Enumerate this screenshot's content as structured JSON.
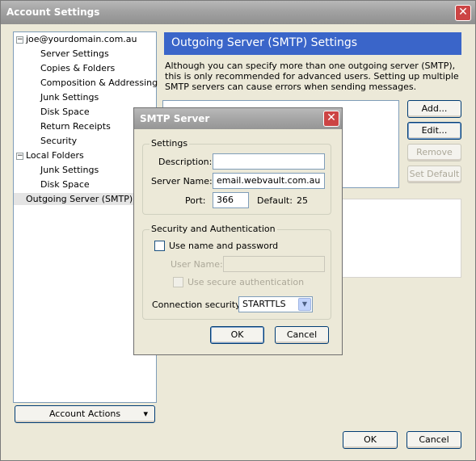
{
  "window": {
    "title": "Account Settings",
    "close_glyph": "✕"
  },
  "tree": {
    "items": [
      {
        "label": "joe@yourdomain.com.au",
        "level": 0,
        "expanded": true
      },
      {
        "label": "Server Settings",
        "level": 1
      },
      {
        "label": "Copies & Folders",
        "level": 1
      },
      {
        "label": "Composition & Addressing",
        "level": 1
      },
      {
        "label": "Junk Settings",
        "level": 1
      },
      {
        "label": "Disk Space",
        "level": 1
      },
      {
        "label": "Return Receipts",
        "level": 1
      },
      {
        "label": "Security",
        "level": 1
      },
      {
        "label": "Local Folders",
        "level": 0,
        "expanded": true
      },
      {
        "label": "Junk Settings",
        "level": 1
      },
      {
        "label": "Disk Space",
        "level": 1
      },
      {
        "label": "Outgoing Server (SMTP)",
        "level": 0,
        "selected": true
      }
    ],
    "expander_glyph": "−"
  },
  "account_actions": {
    "label": "Account Actions",
    "arrow": "▾"
  },
  "panel": {
    "header": "Outgoing Server (SMTP) Settings",
    "description": "Although you can specify more than one outgoing server (SMTP), this is only recommended for advanced users. Setting up multiple SMTP servers can cause errors when sending messages.",
    "buttons": {
      "add": "Add...",
      "edit": "Edit...",
      "remove": "Remove",
      "set_default": "Set Default"
    }
  },
  "footer": {
    "ok": "OK",
    "cancel": "Cancel"
  },
  "dialog": {
    "title": "SMTP Server",
    "settings_group": "Settings",
    "description_label": "Description:",
    "description_value": "",
    "server_name_label": "Server Name:",
    "server_name_value": "email.webvault.com.au",
    "port_label": "Port:",
    "port_value": "366",
    "default_label": "Default:",
    "default_value": "25",
    "security_group": "Security and Authentication",
    "use_name_password": "Use name and password",
    "user_name_label": "User Name:",
    "user_name_value": "",
    "secure_auth": "Use secure authentication",
    "connection_security_label": "Connection security:",
    "connection_security_value": "STARTTLS",
    "ok": "OK",
    "cancel": "Cancel"
  },
  "colors": {
    "header_blue": "#3a65c9",
    "window_bg": "#ece9d8",
    "close_red": "#c44444"
  }
}
